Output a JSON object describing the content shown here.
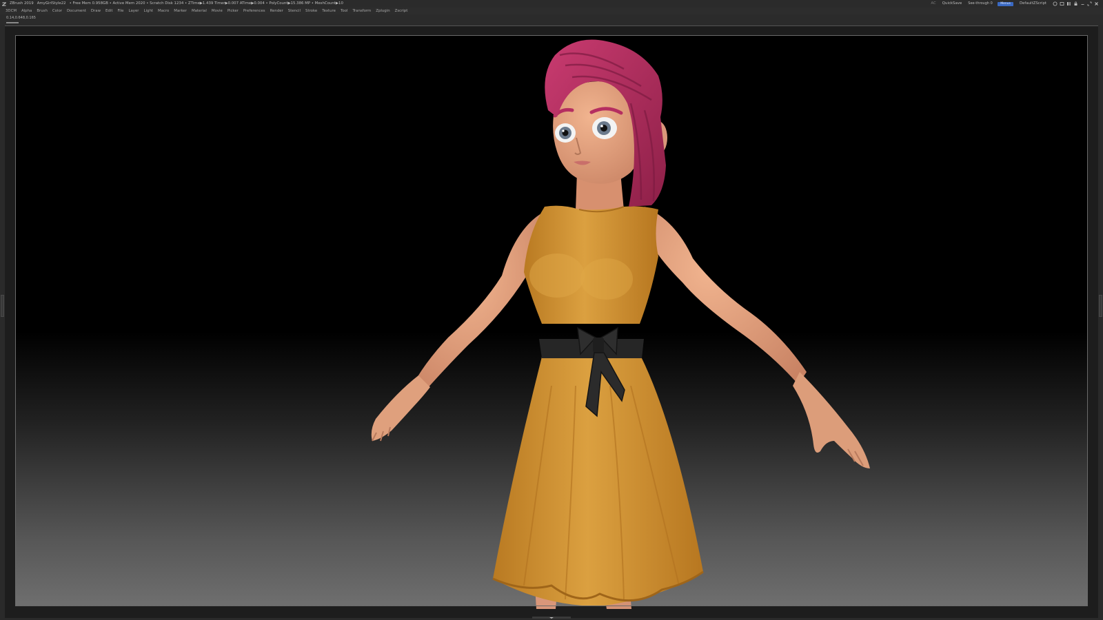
{
  "titlebar": {
    "app": "ZBrush 2019",
    "document": "AmyGirlStyle22",
    "stats": "• Free Mem 0.958GB • Active Mem 2020 • Scratch Disk 1234 • ZTime▶1.439 Timer▶0.007 ATime▶0.004 • PolyCount▶15.386 MP • MeshCount▶10",
    "ac": "AC",
    "quicksave": "QuickSave",
    "see_through_label": "See-through",
    "see_through_value": "0",
    "see_through_fraction": 0.0,
    "menus_toggle": "Menus",
    "script": "DefaultZScript",
    "accent": "#ff9a00",
    "toggle_color": "#3a69c2"
  },
  "menubar": {
    "items": [
      "3DCM",
      "Alpha",
      "Brush",
      "Color",
      "Document",
      "Draw",
      "Edit",
      "File",
      "Layer",
      "Light",
      "Macro",
      "Marker",
      "Material",
      "Movie",
      "Picker",
      "Preferences",
      "Render",
      "Stencil",
      "Stroke",
      "Texture",
      "Tool",
      "Transform",
      "Zplugin",
      "Zscript"
    ]
  },
  "infobar": {
    "coordinates": "0.14,0.648,0.165"
  },
  "icons": {
    "logo": "zbrush-logo-icon",
    "window_controls": [
      "help-icon",
      "layout-icon",
      "palette-icon",
      "lock-icon",
      "minimize-icon",
      "maximize-icon",
      "close-icon"
    ]
  },
  "viewport": {
    "subject": "3D character model",
    "dress_color": "#d8982f",
    "hair_color": "#b92f63",
    "skin_color": "#e3a27e",
    "belt_color": "#262626"
  }
}
